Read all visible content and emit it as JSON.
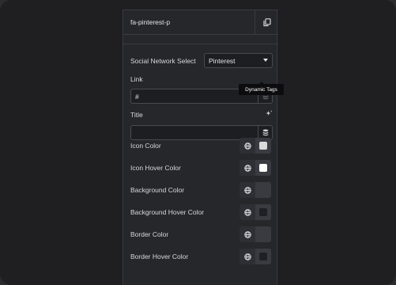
{
  "header": {
    "title": "fa-pinterest-p",
    "copy_icon": "copy-icon"
  },
  "social_network": {
    "label": "Social Network Select",
    "selected": "Pinterest"
  },
  "link": {
    "label": "Link",
    "value": "#",
    "tooltip": "Dynamic Tags"
  },
  "title_field": {
    "label": "Title",
    "value": ""
  },
  "colors": [
    {
      "label": "Icon Color",
      "swatch": "#d9d9d9",
      "filled": true
    },
    {
      "label": "Icon Hover Color",
      "swatch": "#ffffff",
      "filled": true
    },
    {
      "label": "Background Color",
      "swatch": "#3a3b40",
      "filled": false
    },
    {
      "label": "Background Hover Color",
      "swatch": "#1f2023",
      "filled": true
    },
    {
      "label": "Border Color",
      "swatch": "#3a3b40",
      "filled": false
    },
    {
      "label": "Border Hover Color",
      "swatch": "#1f2023",
      "filled": true
    }
  ]
}
